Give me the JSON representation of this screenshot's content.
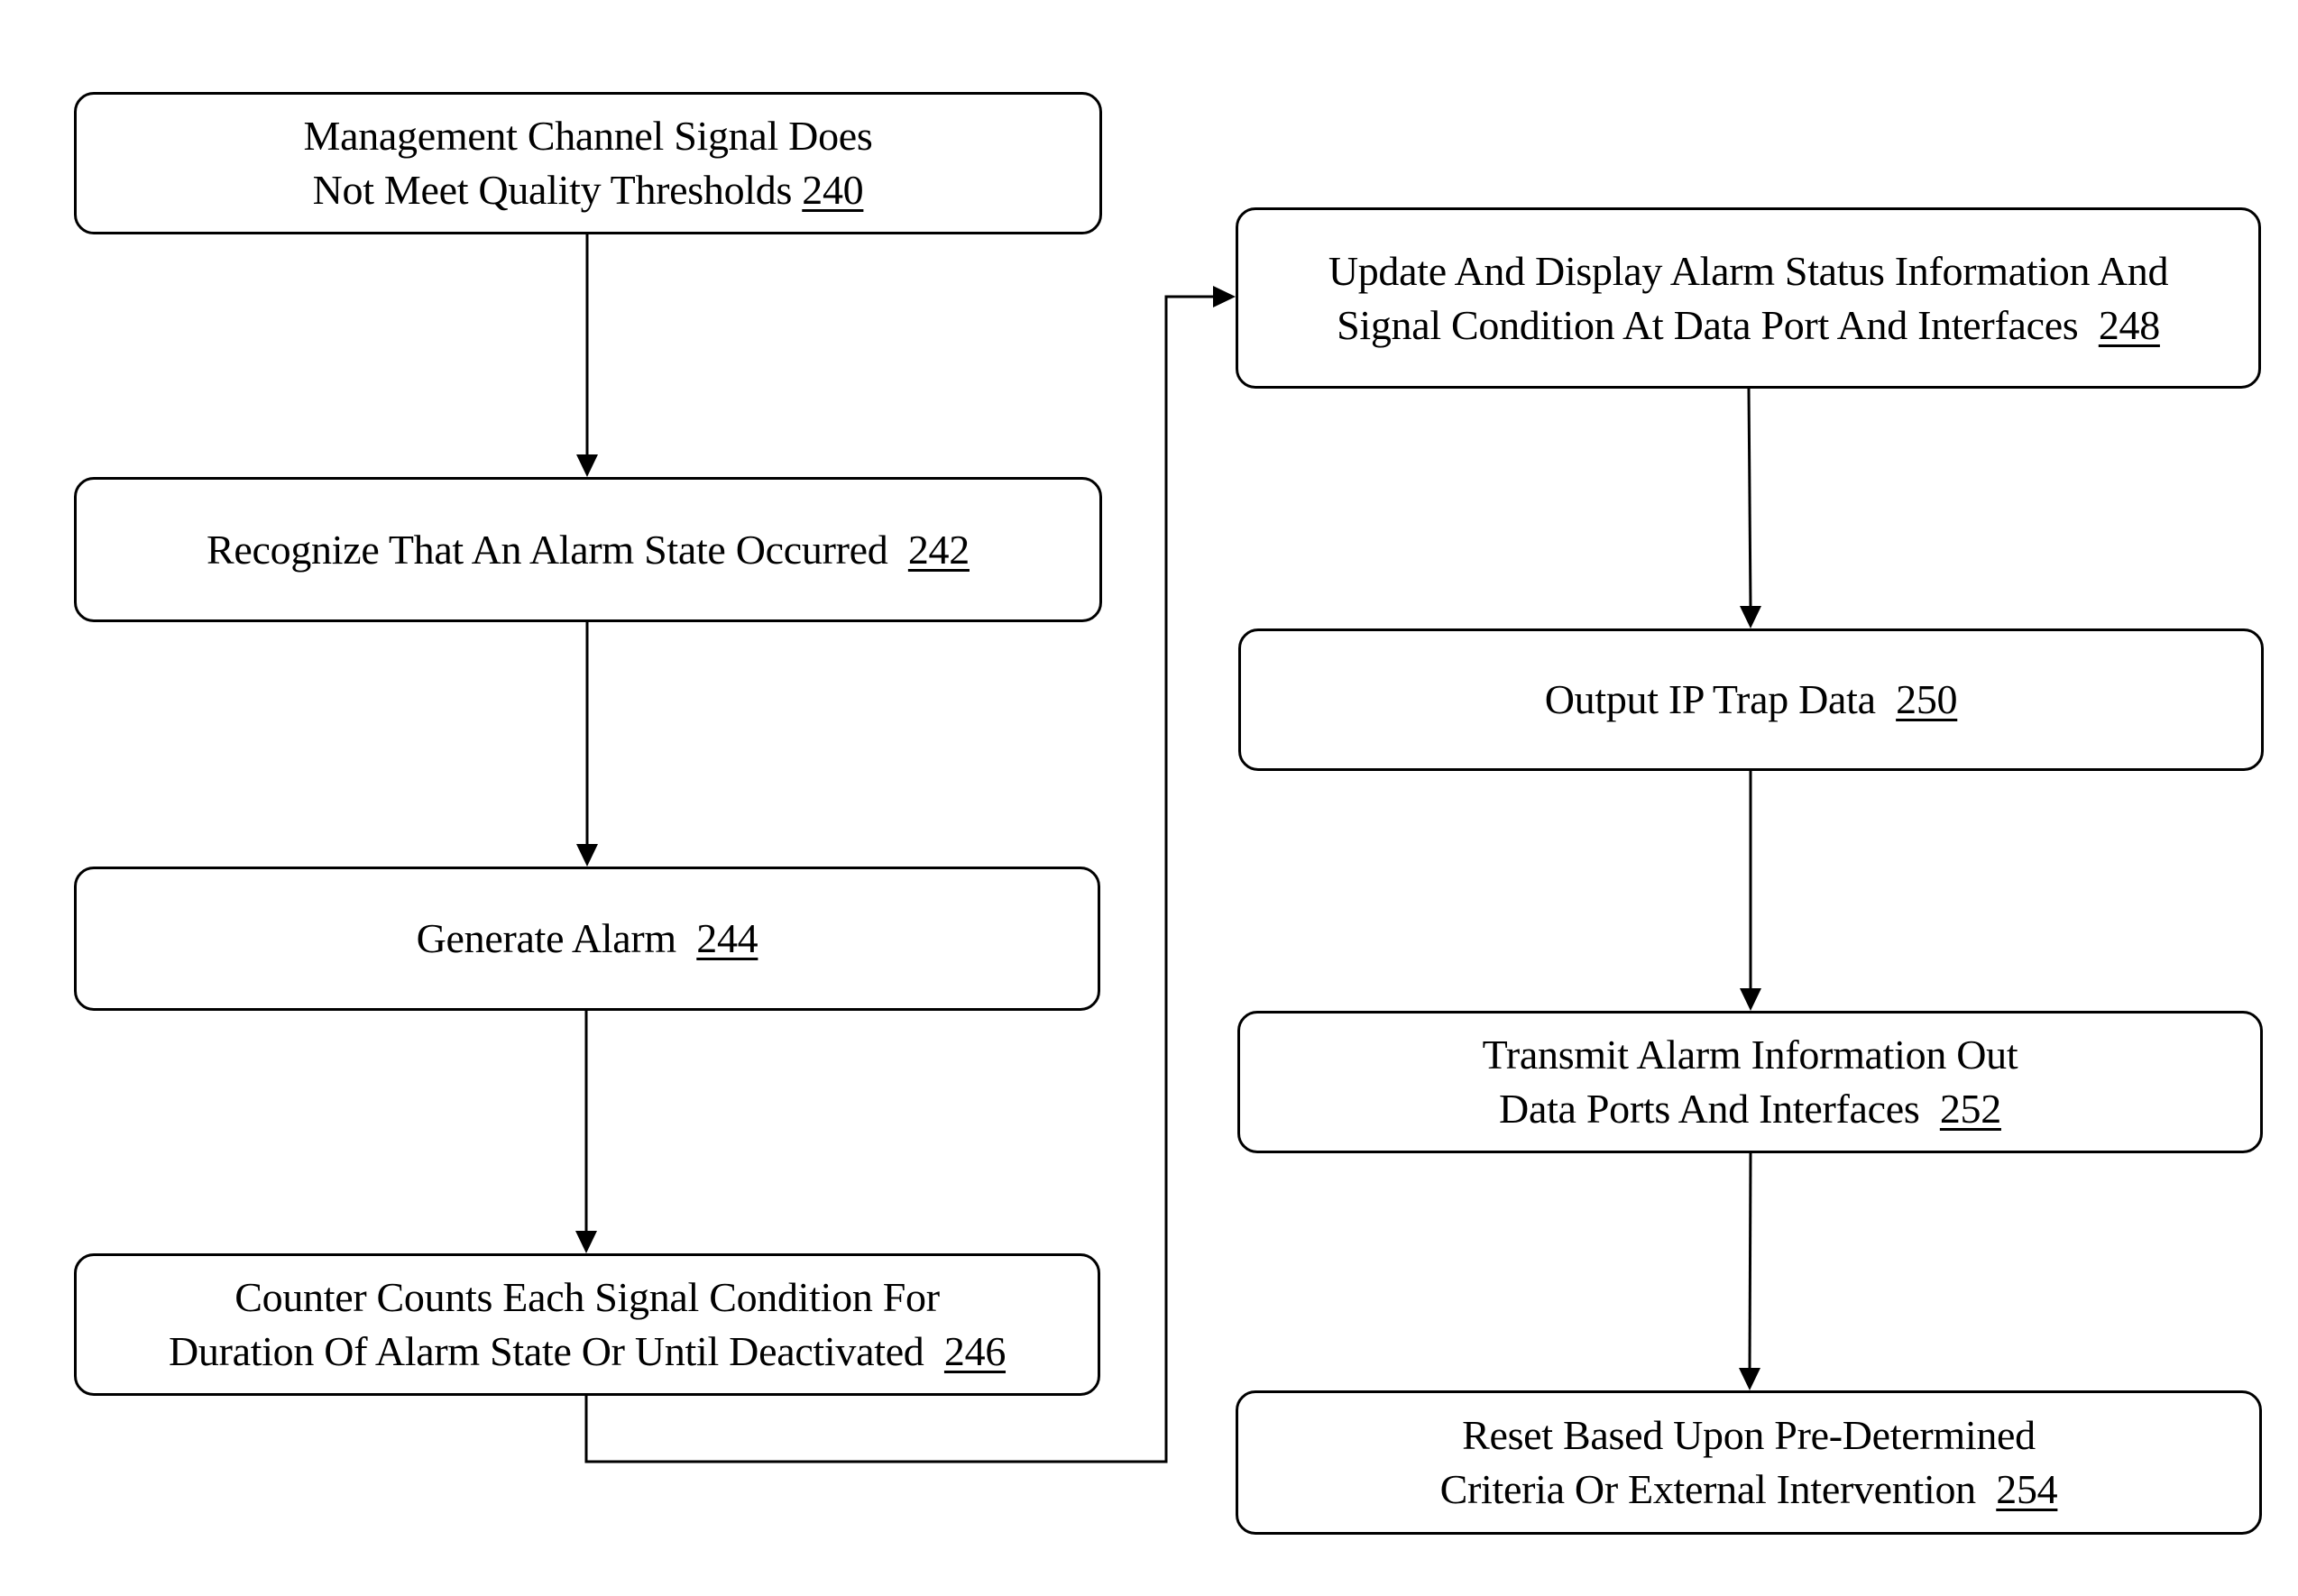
{
  "diagram": {
    "type": "flowchart",
    "steps": [
      {
        "id": "240",
        "lines": [
          "Management Channel Signal Does",
          "Not Meet Quality Thresholds"
        ],
        "ref": "240"
      },
      {
        "id": "242",
        "lines": [
          "Recognize That An Alarm State Occurred"
        ],
        "ref": "242"
      },
      {
        "id": "244",
        "lines": [
          "Generate Alarm"
        ],
        "ref": "244"
      },
      {
        "id": "246",
        "lines": [
          "Counter Counts Each Signal Condition For",
          "Duration Of Alarm State Or Until Deactivated"
        ],
        "ref": "246"
      },
      {
        "id": "248",
        "lines": [
          "Update And Display Alarm Status Information And",
          "Signal Condition At Data Port And Interfaces"
        ],
        "ref": "248"
      },
      {
        "id": "250",
        "lines": [
          "Output IP Trap Data"
        ],
        "ref": "250"
      },
      {
        "id": "252",
        "lines": [
          "Transmit Alarm Information Out",
          "Data Ports And Interfaces"
        ],
        "ref": "252"
      },
      {
        "id": "254",
        "lines": [
          "Reset Based Upon Pre-Determined",
          "Criteria Or External Intervention"
        ],
        "ref": "254"
      }
    ],
    "edges": [
      {
        "from": "240",
        "to": "242"
      },
      {
        "from": "242",
        "to": "244"
      },
      {
        "from": "244",
        "to": "246"
      },
      {
        "from": "246",
        "to": "248"
      },
      {
        "from": "248",
        "to": "250"
      },
      {
        "from": "250",
        "to": "252"
      },
      {
        "from": "252",
        "to": "254"
      }
    ]
  },
  "boxes": {
    "b240": {
      "line1": "Management Channel Signal Does",
      "line2": "Not Meet Quality Thresholds ",
      "ref": "240"
    },
    "b242": {
      "line1": "Recognize That An Alarm State Occurred  ",
      "ref": "242"
    },
    "b244": {
      "line1": "Generate Alarm  ",
      "ref": "244"
    },
    "b246": {
      "line1": "Counter Counts Each Signal Condition For",
      "line2": "Duration Of Alarm State Or Until Deactivated  ",
      "ref": "246"
    },
    "b248": {
      "line1": "Update And Display Alarm Status Information And",
      "line2": "Signal Condition At Data Port And Interfaces  ",
      "ref": "248"
    },
    "b250": {
      "line1": "Output IP Trap Data  ",
      "ref": "250"
    },
    "b252": {
      "line1": "Transmit Alarm Information Out",
      "line2": "Data Ports And Interfaces  ",
      "ref": "252"
    },
    "b254": {
      "line1": "Reset Based Upon Pre-Determined",
      "line2": "Criteria Or External Intervention  ",
      "ref": "254"
    }
  }
}
